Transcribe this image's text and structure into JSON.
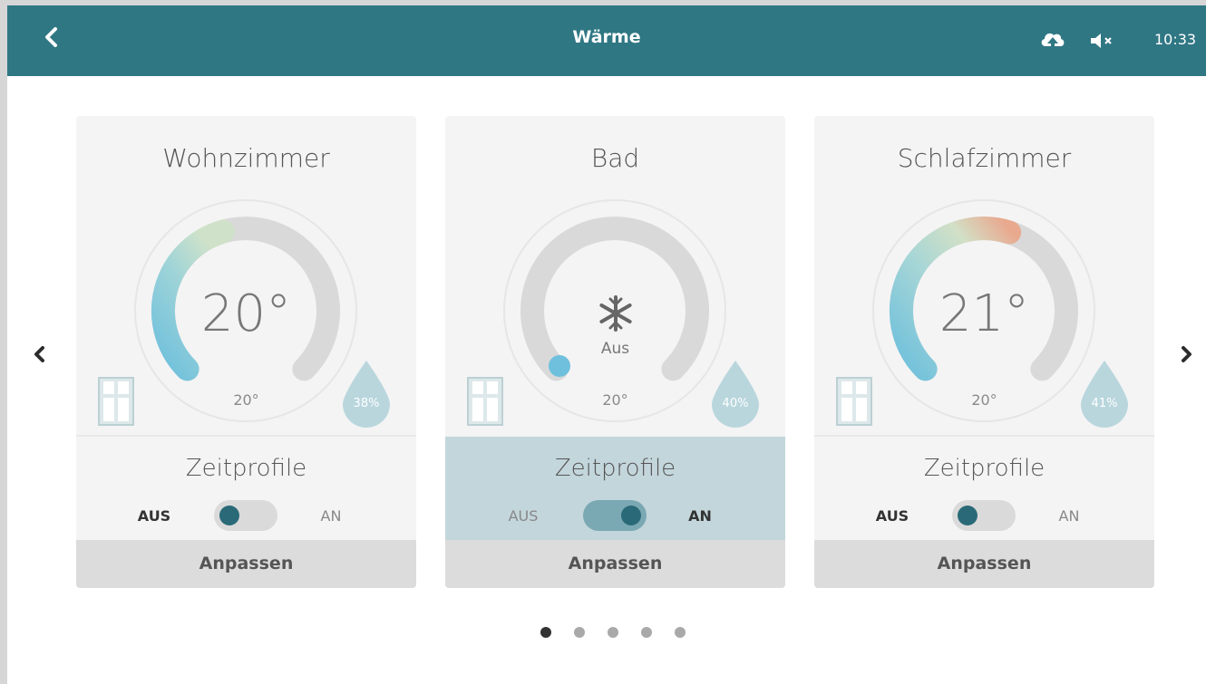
{
  "header": {
    "title": "Wärme",
    "back_icon": "chevron-left-icon",
    "status_icons": [
      "cloud-upload-icon",
      "speaker-mute-icon"
    ],
    "time": "10:33"
  },
  "cards": [
    {
      "room": "Wohnzimmer",
      "current_temp": "20°",
      "status_text": "",
      "setpoint": "20°",
      "humidity": "38%",
      "zeitprofile_label": "Zeitprofile",
      "toggle_off_label": "AUS",
      "toggle_on_label": "AN",
      "toggle_on": false,
      "button_label": "Anpassen"
    },
    {
      "room": "Bad",
      "current_temp": "",
      "status_text": "Aus",
      "setpoint": "20°",
      "humidity": "40%",
      "zeitprofile_label": "Zeitprofile",
      "toggle_off_label": "AUS",
      "toggle_on_label": "AN",
      "toggle_on": true,
      "button_label": "Anpassen"
    },
    {
      "room": "Schlafzimmer",
      "current_temp": "21°",
      "status_text": "",
      "setpoint": "20°",
      "humidity": "41%",
      "zeitprofile_label": "Zeitprofile",
      "toggle_off_label": "AUS",
      "toggle_on_label": "AN",
      "toggle_on": false,
      "button_label": "Anpassen"
    }
  ],
  "pagination": {
    "count": 5,
    "active_index": 0
  },
  "colors": {
    "header_bg": "#307784",
    "active_section_bg": "#c3d6db",
    "gauge_cold": "#6fc0dc",
    "gauge_warm": "#e9a98f"
  }
}
